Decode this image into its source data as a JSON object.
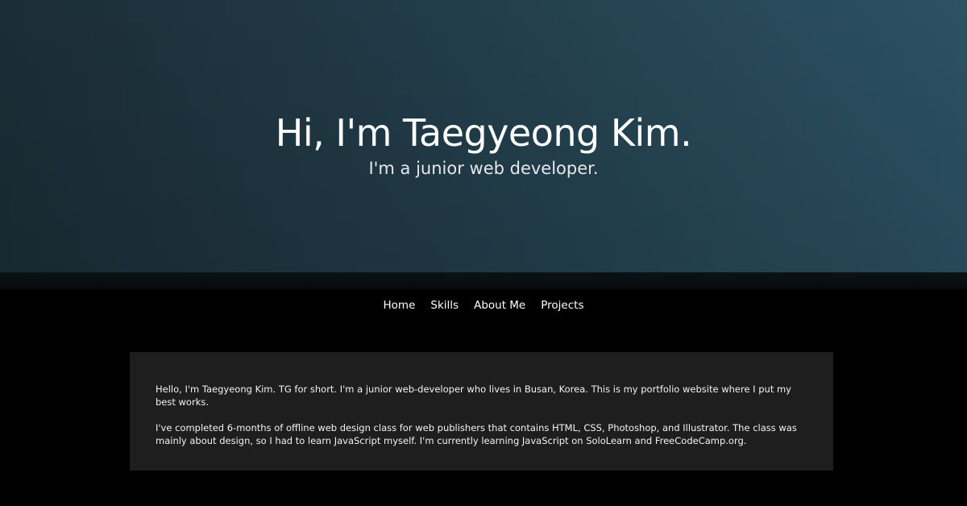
{
  "hero": {
    "title": "Hi, I'm Taegyeong Kim.",
    "subtitle": "I'm a junior web developer."
  },
  "nav": {
    "items": [
      {
        "label": "Home"
      },
      {
        "label": "Skills"
      },
      {
        "label": "About Me"
      },
      {
        "label": "Projects"
      }
    ]
  },
  "about": {
    "paragraphs": [
      "Hello, I'm Taegyeong Kim. TG for short. I'm a junior web-developer who lives in Busan, Korea. This is my portfolio website where I put my best works.",
      "I've completed 6-months of offline web design class for web publishers that contains HTML, CSS, Photoshop, and Illustrator. The class was mainly about design, so I had to learn JavaScript myself. I'm currently learning JavaScript on SoloLearn and FreeCodeCamp.org."
    ]
  },
  "colors": {
    "hero_gradient_start": "#1b2d36",
    "hero_gradient_end": "#2c5263",
    "page_background": "#000000",
    "card_background": "#1e1e1e",
    "text": "#ffffff"
  }
}
